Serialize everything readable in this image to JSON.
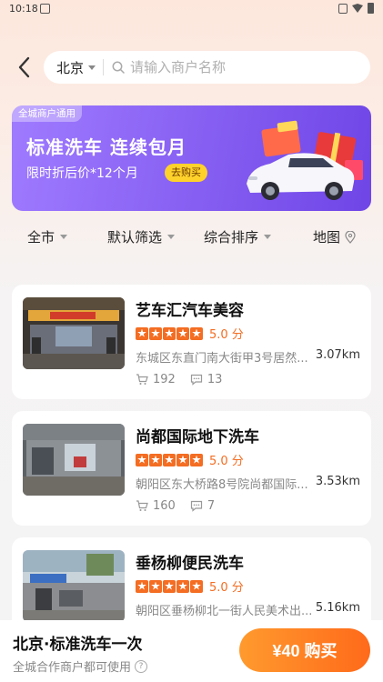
{
  "status_bar": {
    "time": "10:18"
  },
  "header": {
    "city": "北京",
    "search_placeholder": "请输入商户名称"
  },
  "banner": {
    "tag": "全城商户通用",
    "title": "标准洗车 连续包月",
    "subtitle": "限时折后价*12个月",
    "button": "去购买"
  },
  "filters": {
    "region": "全市",
    "screen": "默认筛选",
    "sort": "综合排序",
    "map": "地图"
  },
  "shops": [
    {
      "name": "艺车汇汽车美容",
      "score": "5.0 分",
      "address": "东城区东直门南大街甲3号居然...",
      "distance": "3.07km",
      "orders": "192",
      "comments": "13"
    },
    {
      "name": "尚都国际地下洗车",
      "score": "5.0 分",
      "address": "朝阳区东大桥路8号院尚都国际...",
      "distance": "3.53km",
      "orders": "160",
      "comments": "7"
    },
    {
      "name": "垂杨柳便民洗车",
      "score": "5.0 分",
      "address": "朝阳区垂杨柳北一街人民美术出...",
      "distance": "5.16km",
      "orders": "",
      "comments": ""
    }
  ],
  "bottom_bar": {
    "title": "北京·标准洗车一次",
    "subtitle": "全城合作商户都可使用",
    "buy_label": "¥40 购买"
  },
  "colors": {
    "accent": "#f46d22",
    "banner": "#8a63f4",
    "buy": "#ff7a1f"
  }
}
